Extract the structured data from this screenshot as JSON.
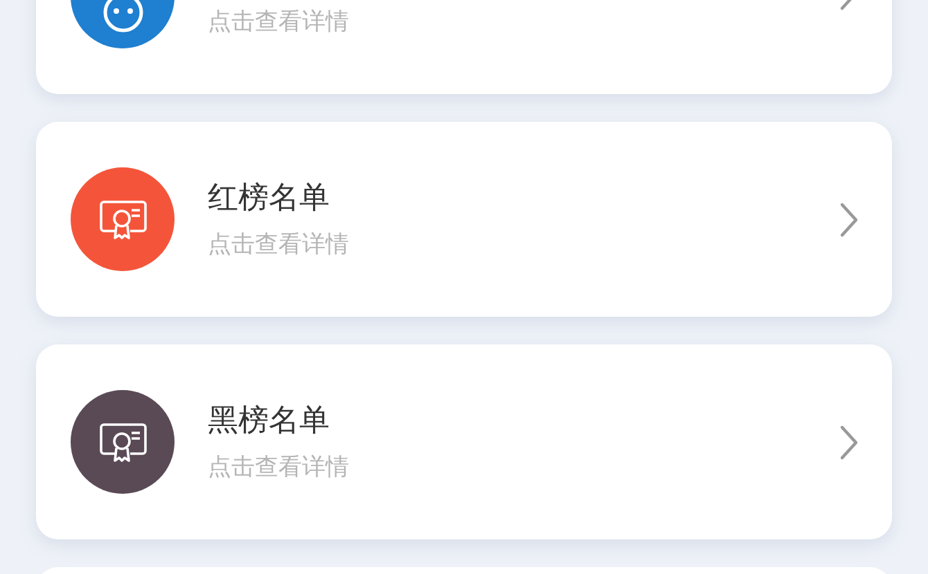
{
  "items": [
    {
      "kind": "baby",
      "color": "#1f7fd0",
      "subtitle": "点击查看详情"
    },
    {
      "kind": "certificate",
      "color": "#f4553a",
      "title": "红榜名单",
      "subtitle": "点击查看详情"
    },
    {
      "kind": "certificate",
      "color": "#5a4a55",
      "title": "黑榜名单",
      "subtitle": "点击查看详情"
    }
  ]
}
